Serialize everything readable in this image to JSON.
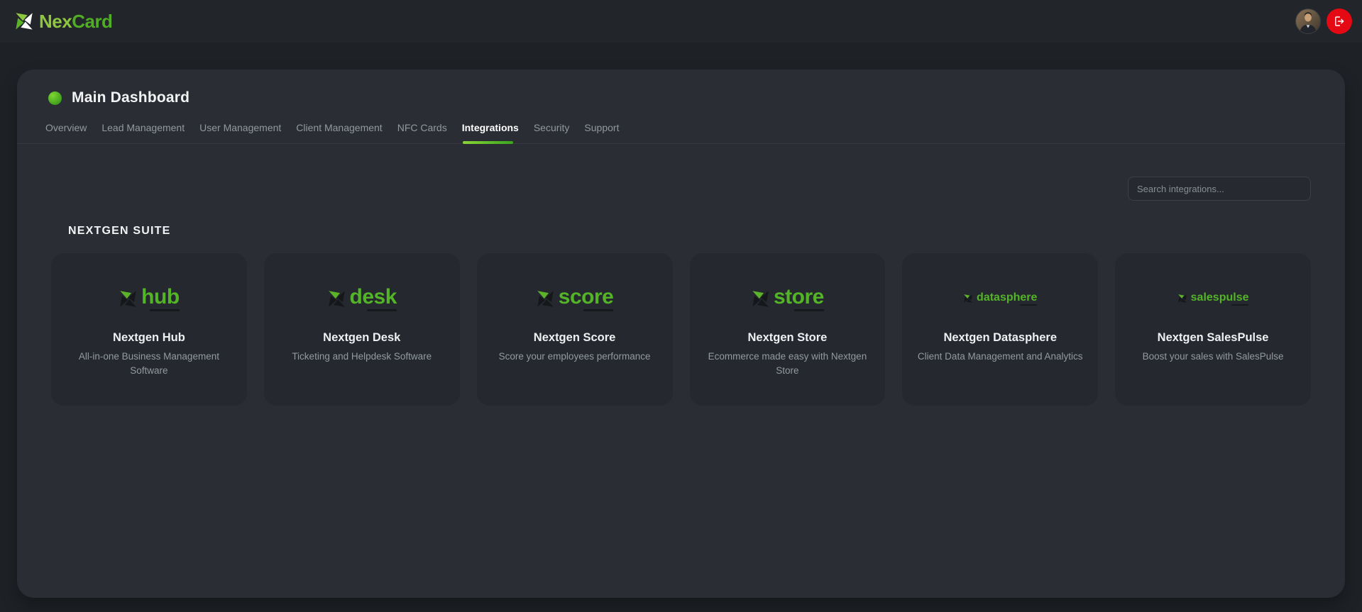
{
  "header": {
    "brand": {
      "prefix": "Nex",
      "suffix": "Card"
    }
  },
  "dashboard": {
    "title": "Main Dashboard",
    "tabs": [
      {
        "label": "Overview",
        "active": false
      },
      {
        "label": "Lead Management",
        "active": false
      },
      {
        "label": "User Management",
        "active": false
      },
      {
        "label": "Client Management",
        "active": false
      },
      {
        "label": "NFC Cards",
        "active": false
      },
      {
        "label": "Integrations",
        "active": true
      },
      {
        "label": "Security",
        "active": false
      },
      {
        "label": "Support",
        "active": false
      }
    ],
    "search_placeholder": "Search integrations...",
    "section_heading": "NEXTGEN SUITE",
    "integrations": [
      {
        "logo_word": "hub",
        "title": "Nextgen Hub",
        "description": "All-in-one Business Management Software"
      },
      {
        "logo_word": "desk",
        "title": "Nextgen Desk",
        "description": "Ticketing and Helpdesk Software"
      },
      {
        "logo_word": "score",
        "title": "Nextgen Score",
        "description": "Score your employees performance"
      },
      {
        "logo_word": "store",
        "title": "Nextgen Store",
        "description": "Ecommerce made easy with Nextgen Store"
      },
      {
        "logo_word": "datasphere",
        "title": "Nextgen Datasphere",
        "description": "Client Data Management and Analytics"
      },
      {
        "logo_word": "salespulse",
        "title": "Nextgen SalesPulse",
        "description": "Boost your sales with SalesPulse"
      }
    ]
  },
  "colors": {
    "accent_green": "#54b427",
    "brand_green_light": "#8dc63f",
    "brand_green_dark": "#4fae24",
    "underline_gradient_from": "#8bd437",
    "underline_gradient_to": "#3aa51f",
    "logout_red": "#e50914",
    "panel_bg": "#2a2d33",
    "card_bg": "#25282e",
    "page_bg": "#1e2126",
    "header_bg": "#22252a"
  }
}
